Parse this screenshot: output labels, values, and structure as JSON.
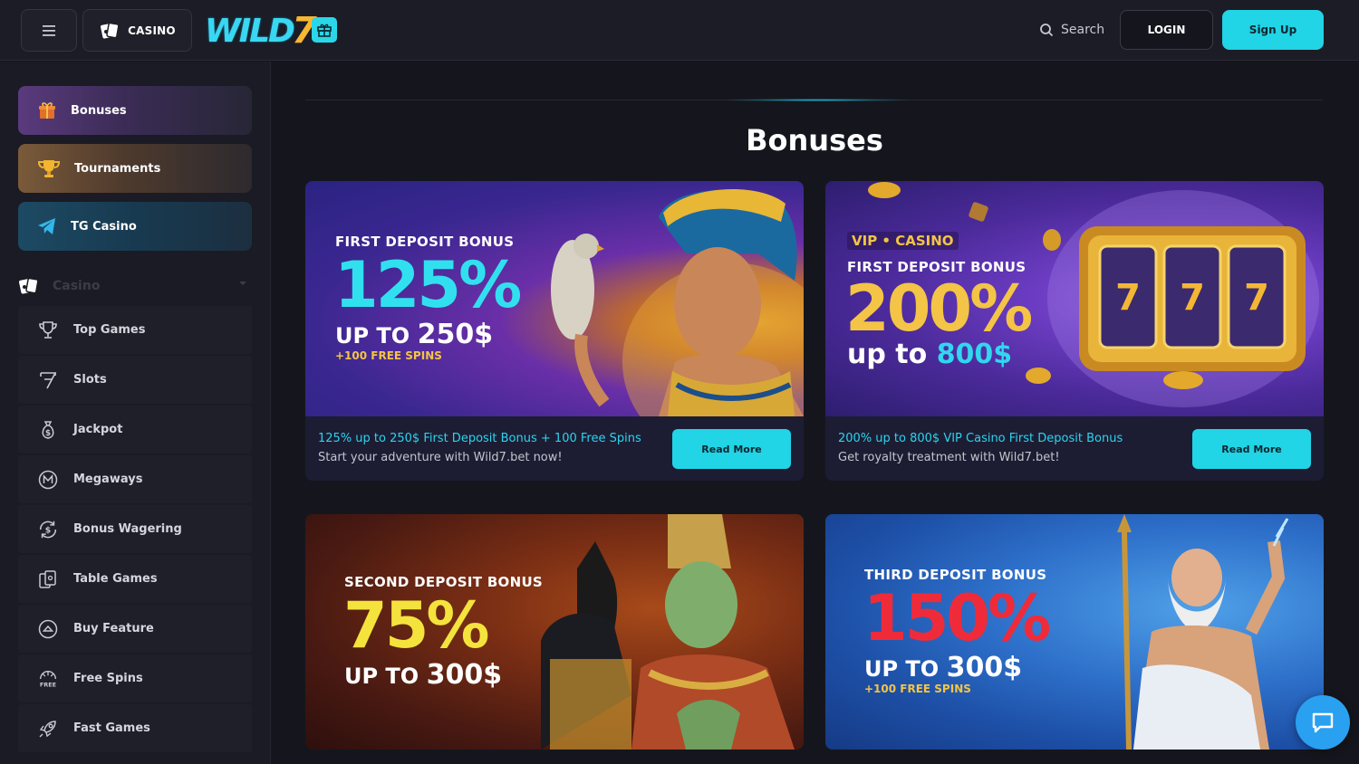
{
  "header": {
    "casino_label": "CASINO",
    "logo_text": "WILD",
    "logo_seven": "7",
    "search_label": "Search",
    "login_label": "LOGIN",
    "signup_label": "Sign Up"
  },
  "sidebar": {
    "promos": [
      {
        "label": "Bonuses",
        "icon": "gift-icon"
      },
      {
        "label": "Tournaments",
        "icon": "trophy-icon"
      },
      {
        "label": "TG Casino",
        "icon": "telegram-icon"
      }
    ],
    "section_label": "Casino",
    "items": [
      {
        "label": "Top Games",
        "icon": "trophy-icon"
      },
      {
        "label": "Slots",
        "icon": "seven-icon"
      },
      {
        "label": "Jackpot",
        "icon": "money-bag-icon"
      },
      {
        "label": "Megaways",
        "icon": "m-circle-icon"
      },
      {
        "label": "Bonus Wagering",
        "icon": "refresh-dollar-icon"
      },
      {
        "label": "Table Games",
        "icon": "cards-icon"
      },
      {
        "label": "Buy Feature",
        "icon": "coin-up-icon"
      },
      {
        "label": "Free Spins",
        "icon": "free-spins-icon"
      },
      {
        "label": "Fast Games",
        "icon": "rocket-icon"
      }
    ]
  },
  "main": {
    "title": "Bonuses",
    "cards": [
      {
        "banner_label": "FIRST DEPOSIT BONUS",
        "banner_percent": "125%",
        "banner_upto": "UP TO",
        "banner_amount": "250$",
        "banner_spins": "+100 FREE SPINS",
        "title": "125% up to 250$ First Deposit Bonus + 100 Free Spins",
        "subtitle": "Start your adventure with Wild7.bet now!",
        "button": "Read More"
      },
      {
        "banner_badge": "VIP • CASINO",
        "banner_label": "FIRST DEPOSIT BONUS",
        "banner_percent": "200%",
        "banner_upto": "up to",
        "banner_amount": "800$",
        "title": "200% up to 800$ VIP Casino First Deposit Bonus",
        "subtitle": "Get royalty treatment with Wild7.bet!",
        "button": "Read More"
      },
      {
        "banner_label": "SECOND DEPOSIT BONUS",
        "banner_percent": "75%",
        "banner_upto": "UP TO",
        "banner_amount": "300$"
      },
      {
        "banner_label": "THIRD DEPOSIT BONUS",
        "banner_percent": "150%",
        "banner_upto": "UP TO",
        "banner_amount": "300$",
        "banner_spins": "+100 FREE SPINS"
      }
    ]
  },
  "colors": {
    "accent": "#21d4e6",
    "background": "#15161d",
    "sidebar": "#1a1b24"
  }
}
